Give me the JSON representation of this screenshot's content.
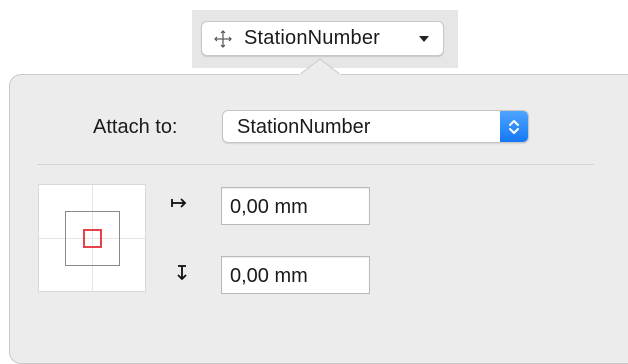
{
  "toolbar": {
    "object_name": "StationNumber",
    "icons": {
      "move": "move-crosshair-icon",
      "dropdown": "chevron-down-icon"
    }
  },
  "popover": {
    "attach_label": "Attach to:",
    "attach_value": "StationNumber",
    "attach_control_icon": "up-down-stepper-icon",
    "accent_color": "#1478f5",
    "anchor_marker_color": "#e8404d",
    "offsets": [
      {
        "axis": "horizontal",
        "icon": "arrow-right-bar-icon",
        "value": "0,00 mm"
      },
      {
        "axis": "vertical",
        "icon": "arrow-down-bar-icon",
        "value": "0,00 mm"
      }
    ]
  }
}
